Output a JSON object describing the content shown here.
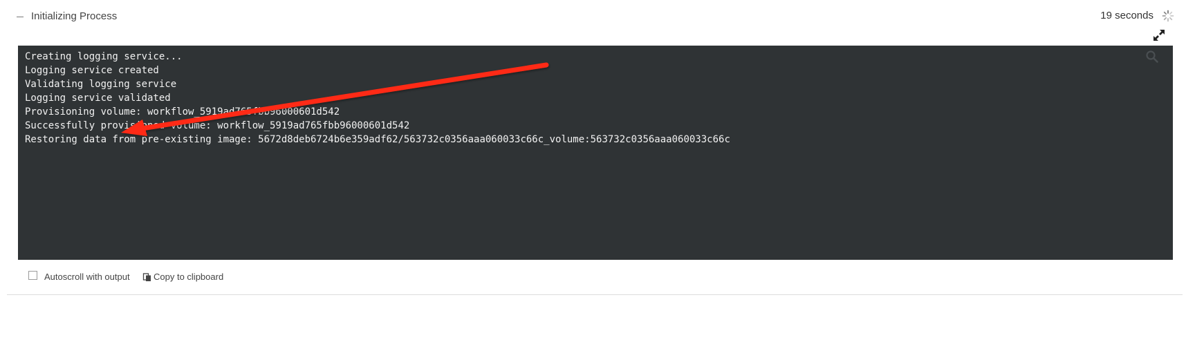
{
  "header": {
    "title": "Initializing Process",
    "duration": "19 seconds",
    "collapse_icon": "minus-icon",
    "status_icon": "spinner-icon",
    "expand_icon": "expand-icon"
  },
  "console": {
    "search_icon": "search-icon",
    "lines": [
      "Creating logging service...",
      "Logging service created",
      "Validating logging service",
      "Logging service validated",
      "Provisioning volume: workflow_5919ad765fbb96000601d542",
      "Successfully provisioned volume: workflow_5919ad765fbb96000601d542",
      "Restoring data from pre-existing image: 5672d8deb6724b6e359adf62/563732c0356aaa060033c66c_volume:563732c0356aaa060033c66c"
    ]
  },
  "annotation": {
    "arrow_color": "#ff2a12"
  },
  "footer": {
    "autoscroll_label": "Autoscroll with output",
    "autoscroll_checked": false,
    "copy_label": "Copy to clipboard",
    "copy_icon": "clipboard-icon"
  },
  "colors": {
    "console_background": "#2f3335",
    "console_text": "#f2f2f2"
  }
}
